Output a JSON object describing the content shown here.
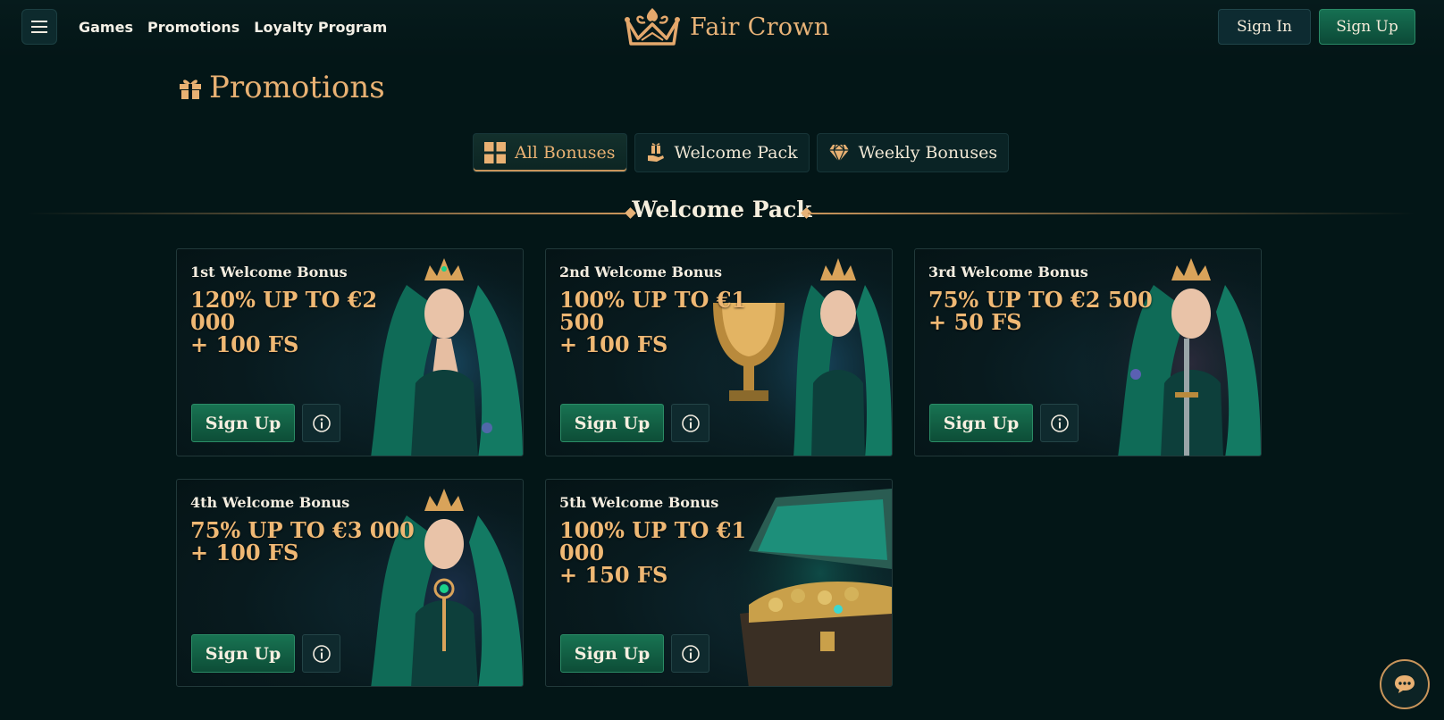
{
  "header": {
    "nav": [
      "Games",
      "Promotions",
      "Loyalty Program"
    ],
    "logo_text": "Fair Crown",
    "sign_in": "Sign In",
    "sign_up": "Sign Up"
  },
  "page": {
    "title": "Promotions",
    "tabs": [
      {
        "label": "All Bonuses",
        "icon": "grid-icon",
        "active": true
      },
      {
        "label": "Welcome Pack",
        "icon": "gift-hand-icon",
        "active": false
      },
      {
        "label": "Weekly Bonuses",
        "icon": "diamond-icon",
        "active": false
      }
    ],
    "section_title": "Welcome Pack"
  },
  "cards": [
    {
      "label": "1st Welcome Bonus",
      "line1": "120% UP TO €2 000",
      "line2": "+ 100 FS",
      "button": "Sign Up",
      "art": "elf-queen"
    },
    {
      "label": "2nd Welcome Bonus",
      "line1": "100% UP TO €1 500",
      "line2": "+ 100 FS",
      "button": "Sign Up",
      "art": "elf-queen-trophy"
    },
    {
      "label": "3rd Welcome Bonus",
      "line1": "75% UP TO €2 500",
      "line2": "+ 50 FS",
      "button": "Sign Up",
      "art": "elf-queen-sword"
    },
    {
      "label": "4th Welcome Bonus",
      "line1": "75% UP TO €3 000",
      "line2": "+ 100 FS",
      "button": "Sign Up",
      "art": "elf-queen-key"
    },
    {
      "label": "5th Welcome Bonus",
      "line1": "100% UP TO €1 000",
      "line2": "+ 150 FS",
      "button": "Sign Up",
      "art": "treasure-chest"
    }
  ],
  "colors": {
    "background": "#031617",
    "gold": "#e9b173",
    "green": "#187352"
  }
}
